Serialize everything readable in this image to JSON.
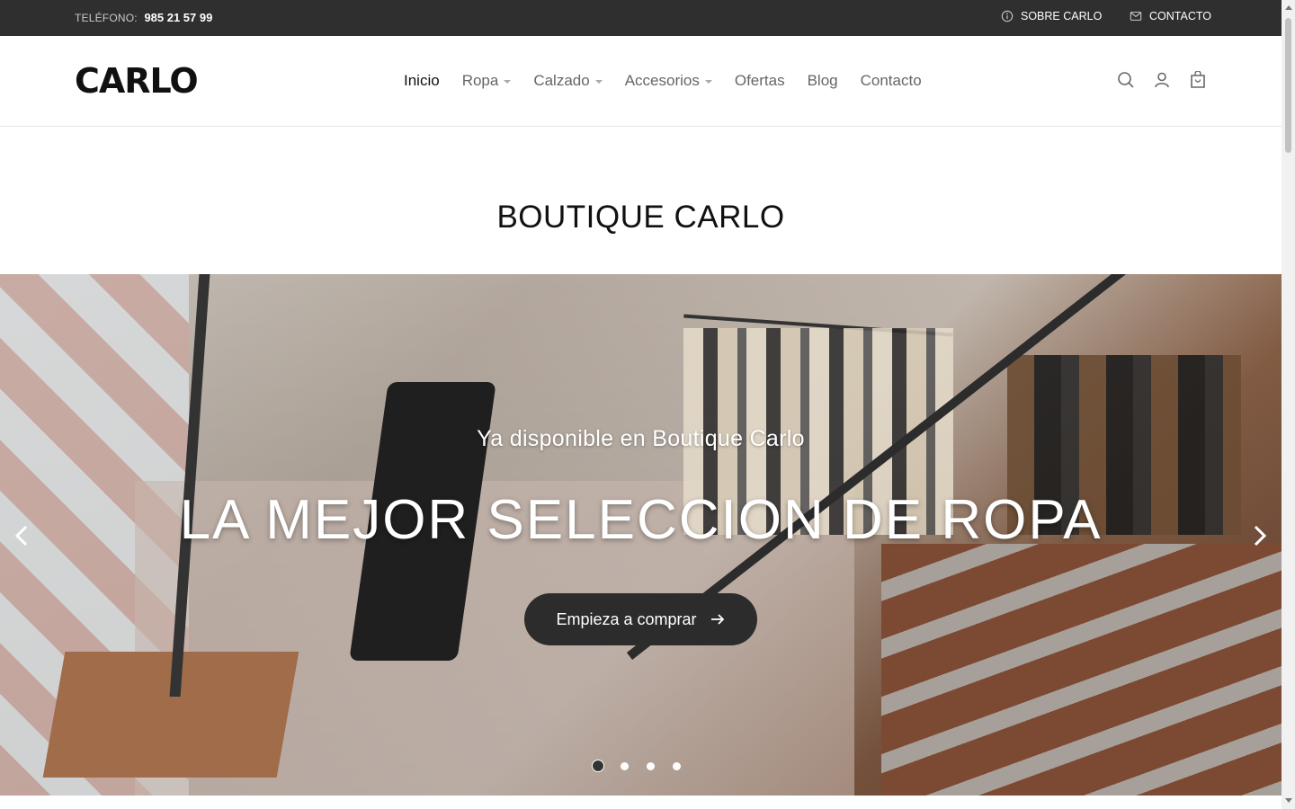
{
  "topbar": {
    "phone_label": "TELÉFONO:",
    "phone_number": "985 21 57 99",
    "about_label": "SOBRE CARLO",
    "contact_label": "CONTACTO"
  },
  "header": {
    "logo_text": "CARLO",
    "nav": [
      {
        "label": "Inicio",
        "has_dropdown": false,
        "active": true
      },
      {
        "label": "Ropa",
        "has_dropdown": true
      },
      {
        "label": "Calzado",
        "has_dropdown": true
      },
      {
        "label": "Accesorios",
        "has_dropdown": true
      },
      {
        "label": "Ofertas",
        "has_dropdown": false
      },
      {
        "label": "Blog",
        "has_dropdown": false
      },
      {
        "label": "Contacto",
        "has_dropdown": false
      }
    ],
    "icons": [
      "search-icon",
      "user-icon",
      "cart-icon"
    ]
  },
  "page": {
    "title": "BOUTIQUE CARLO"
  },
  "hero": {
    "subtitle": "Ya disponible en Boutique Carlo",
    "title": "LA MEJOR SELECCION DE ROPA",
    "cta_label": "Empieza a comprar",
    "slide_count": 4,
    "active_slide": 1
  },
  "colors": {
    "topbar_bg": "#2f2f2f",
    "button_bg": "#2c2c2c",
    "text_dark": "#111111"
  }
}
